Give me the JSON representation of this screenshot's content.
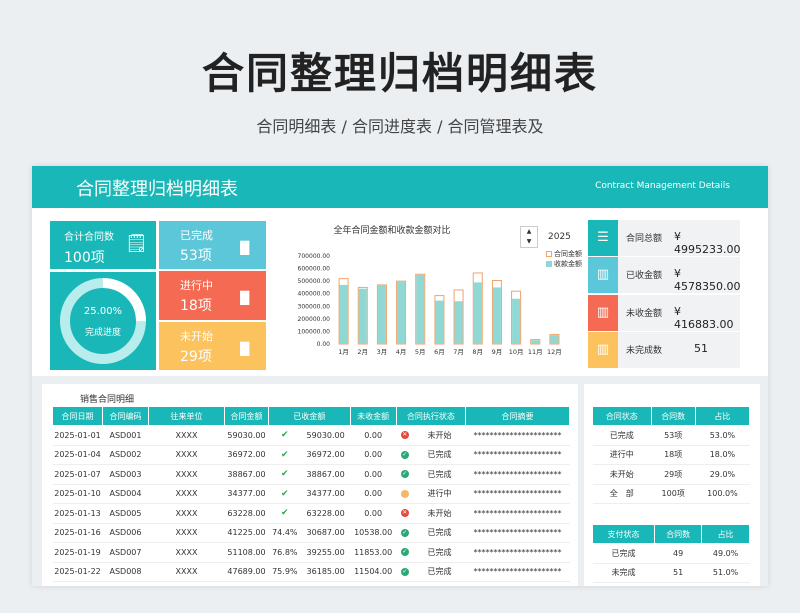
{
  "hero": {
    "title": "合同整理归档明细表",
    "subtitle": "合同明细表  /  合同进度表 / 合同管理表及"
  },
  "banner": {
    "title": "合同整理归档明细表",
    "subtitle_en": "Contract Management Details"
  },
  "kpi": {
    "total_label": "合计合同数",
    "total_value": "100项",
    "progress_percent": "25.00%",
    "progress_label": "完成进度",
    "progress_fraction": 0.25
  },
  "stats": [
    {
      "label": "已完成",
      "value": "53项",
      "color": "#5bc7d8"
    },
    {
      "label": "进行中",
      "value": "18项",
      "color": "#f46a52"
    },
    {
      "label": "未开始",
      "value": "29项",
      "color": "#fbc25d"
    }
  ],
  "chart_data": {
    "type": "bar",
    "title": "全年合同金额和收款金额对比",
    "year": "2025",
    "categories": [
      "1月",
      "2月",
      "3月",
      "4月",
      "5月",
      "6月",
      "7月",
      "8月",
      "9月",
      "10月",
      "11月",
      "12月"
    ],
    "series": [
      {
        "name": "合同金额",
        "values": [
          520000,
          450000,
          470000,
          500000,
          555000,
          385000,
          430000,
          565000,
          505000,
          420000,
          35000,
          75000
        ]
      },
      {
        "name": "收款金额",
        "values": [
          470000,
          440000,
          465000,
          495000,
          550000,
          345000,
          340000,
          490000,
          450000,
          360000,
          30000,
          70000
        ]
      }
    ],
    "yticks": [
      "0.00",
      "100000.00",
      "200000.00",
      "300000.00",
      "400000.00",
      "500000.00",
      "600000.00",
      "700000.00"
    ],
    "ylim": [
      0,
      700000
    ],
    "colors": {
      "contract": "#f0a36a",
      "received": "#8fd8d3"
    }
  },
  "right_cards": [
    {
      "label": "合同总额",
      "value": "¥  4995233.00",
      "color": "#19b7b7",
      "icon": "money-icon"
    },
    {
      "label": "已收金额",
      "value": "¥  4578350.00",
      "color": "#5bc7d8",
      "icon": "chart-icon"
    },
    {
      "label": "未收金额",
      "value": "¥  416883.00",
      "color": "#f46a52",
      "icon": "chart-icon"
    },
    {
      "label": "未完成数",
      "value": "51",
      "color": "#fbc25d",
      "icon": "chart-icon"
    }
  ],
  "detail": {
    "title": "销售合同明细",
    "headers": [
      "合同日期",
      "合同编码",
      "往来单位",
      "合同金额",
      "已收金额",
      "",
      "未收金额",
      "合同执行状态",
      "",
      "合同摘要"
    ],
    "rows": [
      {
        "date": "2025-01-01",
        "code": "ASD001",
        "unit": "XXXX",
        "amount": "59030.00",
        "pct": "",
        "received": "59030.00",
        "mark": "check",
        "unpaid": "0.00",
        "dot": "red",
        "status": "未开始",
        "summary": "**********************"
      },
      {
        "date": "2025-01-04",
        "code": "ASD002",
        "unit": "XXXX",
        "amount": "36972.00",
        "pct": "",
        "received": "36972.00",
        "mark": "check",
        "unpaid": "0.00",
        "dot": "green",
        "status": "已完成",
        "summary": "**********************"
      },
      {
        "date": "2025-01-07",
        "code": "ASD003",
        "unit": "XXXX",
        "amount": "38867.00",
        "pct": "",
        "received": "38867.00",
        "mark": "check",
        "unpaid": "0.00",
        "dot": "green",
        "status": "已完成",
        "summary": "**********************"
      },
      {
        "date": "2025-01-10",
        "code": "ASD004",
        "unit": "XXXX",
        "amount": "34377.00",
        "pct": "",
        "received": "34377.00",
        "mark": "check",
        "unpaid": "0.00",
        "dot": "orange",
        "status": "进行中",
        "summary": "**********************"
      },
      {
        "date": "2025-01-13",
        "code": "ASD005",
        "unit": "XXXX",
        "amount": "63228.00",
        "pct": "",
        "received": "63228.00",
        "mark": "check",
        "unpaid": "0.00",
        "dot": "red",
        "status": "未开始",
        "summary": "**********************"
      },
      {
        "date": "2025-01-16",
        "code": "ASD006",
        "unit": "XXXX",
        "amount": "41225.00",
        "pct": "74.4%",
        "received": "30687.00",
        "mark": "",
        "unpaid": "10538.00",
        "dot": "green",
        "status": "已完成",
        "summary": "**********************"
      },
      {
        "date": "2025-01-19",
        "code": "ASD007",
        "unit": "XXXX",
        "amount": "51108.00",
        "pct": "76.8%",
        "received": "39255.00",
        "mark": "",
        "unpaid": "11853.00",
        "dot": "green",
        "status": "已完成",
        "summary": "**********************"
      },
      {
        "date": "2025-01-22",
        "code": "ASD008",
        "unit": "XXXX",
        "amount": "47689.00",
        "pct": "75.9%",
        "received": "36185.00",
        "mark": "",
        "unpaid": "11504.00",
        "dot": "green",
        "status": "已完成",
        "summary": "**********************"
      }
    ]
  },
  "status_table": {
    "headers": [
      "合同状态",
      "合同数",
      "占比"
    ],
    "rows": [
      [
        "已完成",
        "53项",
        "53.0%"
      ],
      [
        "进行中",
        "18项",
        "18.0%"
      ],
      [
        "未开始",
        "29项",
        "29.0%"
      ],
      [
        "全　部",
        "100项",
        "100.0%"
      ]
    ]
  },
  "pay_table": {
    "headers": [
      "支付状态",
      "合同数",
      "占比"
    ],
    "rows": [
      [
        "已完成",
        "49",
        "49.0%"
      ],
      [
        "未完成",
        "51",
        "51.0%"
      ]
    ]
  }
}
